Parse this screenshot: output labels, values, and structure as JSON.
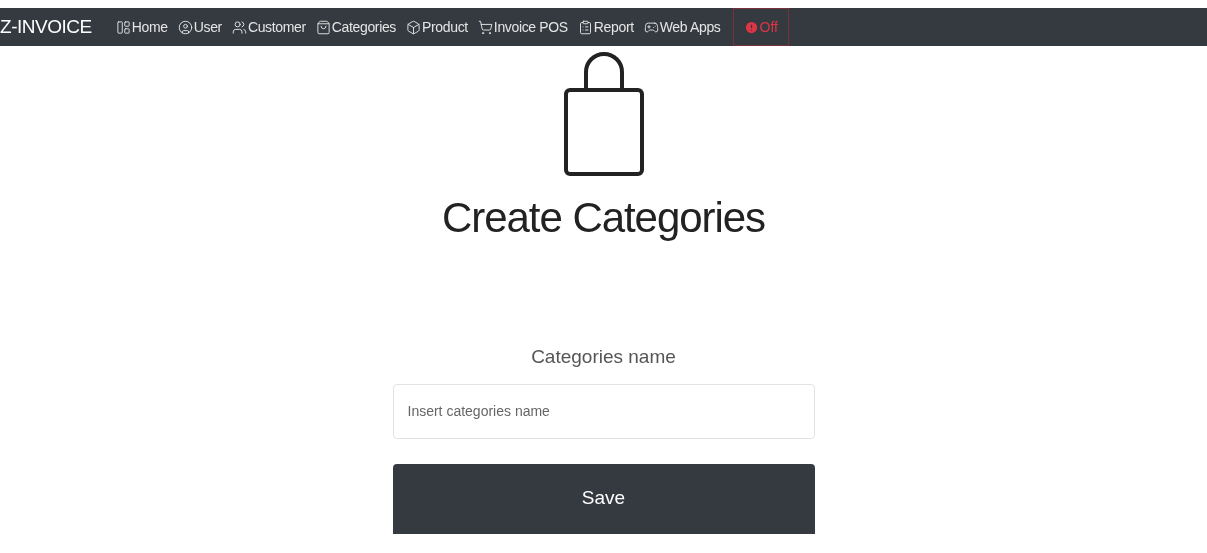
{
  "navbar": {
    "brand": "Z-INVOICE",
    "items": [
      {
        "label": "Home"
      },
      {
        "label": "User"
      },
      {
        "label": "Customer"
      },
      {
        "label": "Categories"
      },
      {
        "label": "Product"
      },
      {
        "label": "Invoice POS"
      },
      {
        "label": "Report"
      },
      {
        "label": "Web Apps"
      }
    ],
    "logout_button": {
      "label": "Off"
    }
  },
  "heading": "Create Categories",
  "form": {
    "label": "Categories name",
    "placeholder": "Insert categories name",
    "submit": "Save"
  }
}
